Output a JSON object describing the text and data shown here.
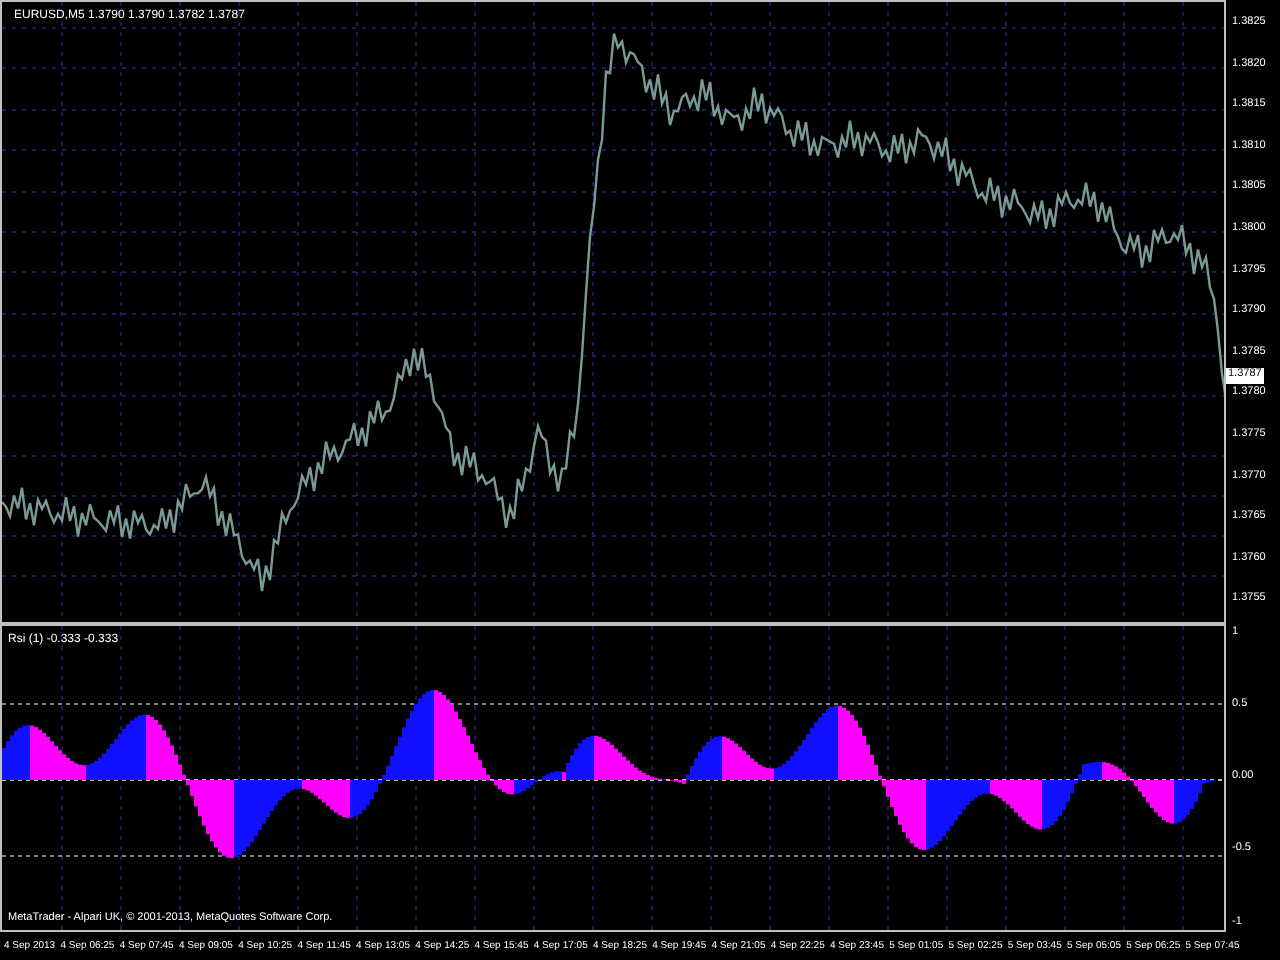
{
  "main_chart": {
    "title": "EURUSD,M5 1.3790 1.3790 1.3782 1.3787",
    "price_labels": [
      "1.3825",
      "1.3820",
      "1.3815",
      "1.3810",
      "1.3805",
      "1.3800",
      "1.3795",
      "1.3790",
      "1.3785",
      "1.3780",
      "1.3775",
      "1.3770",
      "1.3765",
      "1.3760",
      "1.3755"
    ],
    "current_price": "1.3787"
  },
  "indicator": {
    "title": "Rsi (1) -0.333 -0.333",
    "levels": [
      "1",
      "0.5",
      "0.00",
      "-0.5",
      "-1"
    ]
  },
  "footer": "MetaTrader - Alpari UK, © 2001-2013, MetaQuotes Software Corp.",
  "time_labels": [
    "4 Sep 2013",
    "4 Sep 06:25",
    "4 Sep 07:45",
    "4 Sep 09:05",
    "4 Sep 10:25",
    "4 Sep 11:45",
    "4 Sep 13:05",
    "4 Sep 14:25",
    "4 Sep 15:45",
    "4 Sep 17:05",
    "4 Sep 18:25",
    "4 Sep 19:45",
    "4 Sep 21:05",
    "4 Sep 22:25",
    "4 Sep 23:45",
    "5 Sep 01:05",
    "5 Sep 02:25",
    "5 Sep 03:45",
    "5 Sep 05:05",
    "5 Sep 06:25",
    "5 Sep 07:45"
  ]
}
